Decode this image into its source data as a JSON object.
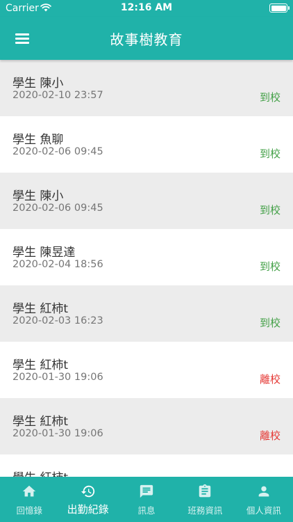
{
  "status_bar": {
    "carrier": "Carrier",
    "time": "12:16 AM"
  },
  "header": {
    "title": "故事樹教育",
    "menu_icon": "menu-icon"
  },
  "colors": {
    "accent": "#20b2a9",
    "arrive": "#43a047",
    "leave": "#e53935",
    "alt_row": "#ececec"
  },
  "records": [
    {
      "name": "學生 陳小",
      "time": "2020-02-10 23:57",
      "status": "到校",
      "status_type": "arrive"
    },
    {
      "name": "學生 魚聊",
      "time": "2020-02-06 09:45",
      "status": "到校",
      "status_type": "arrive"
    },
    {
      "name": "學生 陳小",
      "time": "2020-02-06 09:45",
      "status": "到校",
      "status_type": "arrive"
    },
    {
      "name": "學生 陳昱達",
      "time": "2020-02-04 18:56",
      "status": "到校",
      "status_type": "arrive"
    },
    {
      "name": "學生 紅柿t",
      "time": "2020-02-03 16:23",
      "status": "到校",
      "status_type": "arrive"
    },
    {
      "name": "學生 紅柿t",
      "time": "2020-01-30 19:06",
      "status": "離校",
      "status_type": "leave"
    },
    {
      "name": "學生 紅柿t",
      "time": "2020-01-30 19:06",
      "status": "離校",
      "status_type": "leave"
    },
    {
      "name": "學生 紅柿t",
      "time": "",
      "status": "",
      "status_type": "arrive"
    }
  ],
  "bottom_nav": {
    "active_index": 1,
    "tabs": [
      {
        "label": "回憶錄",
        "icon": "home-icon"
      },
      {
        "label": "出勤紀錄",
        "icon": "history-icon"
      },
      {
        "label": "訊息",
        "icon": "chat-icon"
      },
      {
        "label": "班務資訊",
        "icon": "clipboard-icon"
      },
      {
        "label": "個人資訊",
        "icon": "person-icon"
      }
    ]
  }
}
